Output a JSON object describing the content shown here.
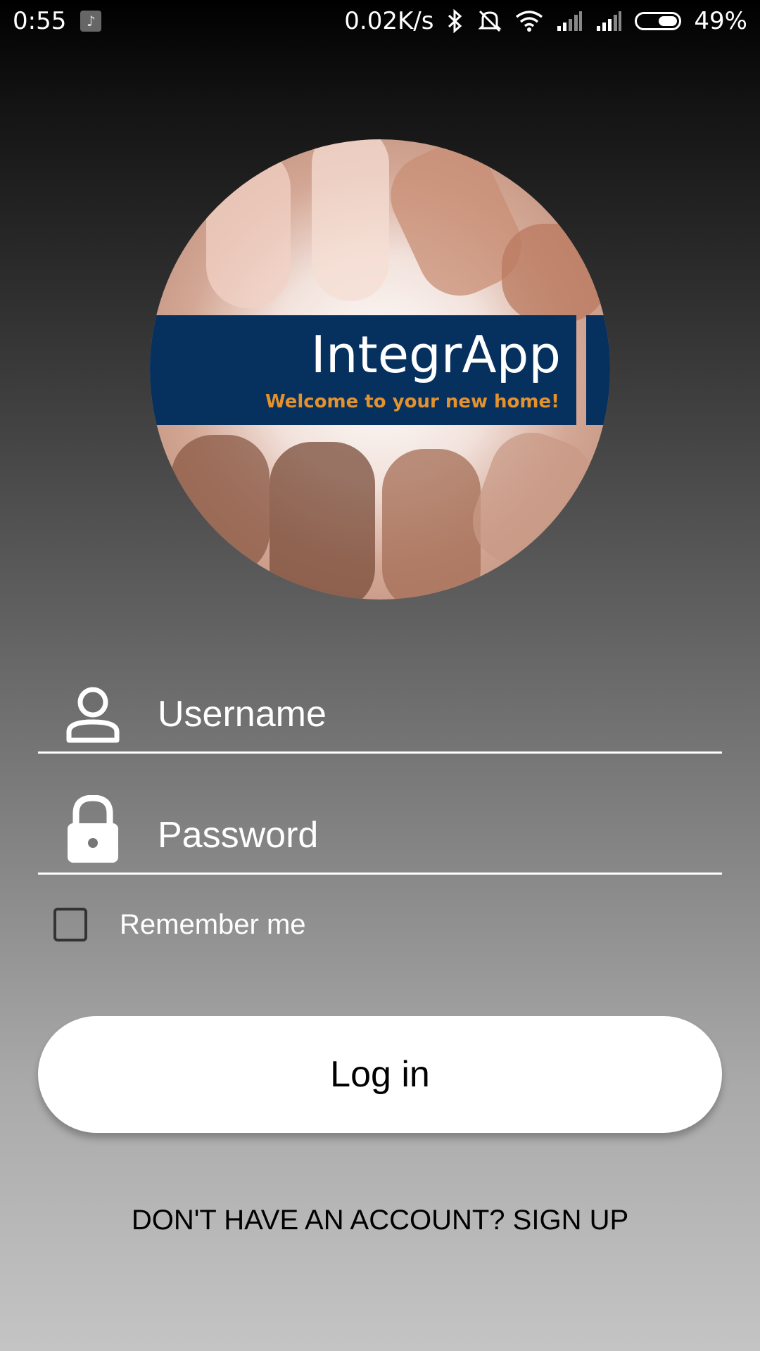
{
  "status_bar": {
    "time": "0:55",
    "network_speed": "0.02K/s",
    "battery_percent": "49%",
    "battery_level": 0.49,
    "icons": [
      "music-icon",
      "bluetooth-icon",
      "mute-icon",
      "wifi-icon",
      "signal-icon",
      "signal-icon",
      "battery-icon"
    ]
  },
  "logo": {
    "title": "IntegrApp",
    "subtitle": "Welcome to your new home!",
    "band_color": "#06305e",
    "subtitle_color": "#e5922c"
  },
  "form": {
    "username_placeholder": "Username",
    "password_placeholder": "Password",
    "remember_label": "Remember me",
    "login_label": "Log in",
    "signup_label": "DON'T HAVE AN ACCOUNT? SIGN UP"
  }
}
